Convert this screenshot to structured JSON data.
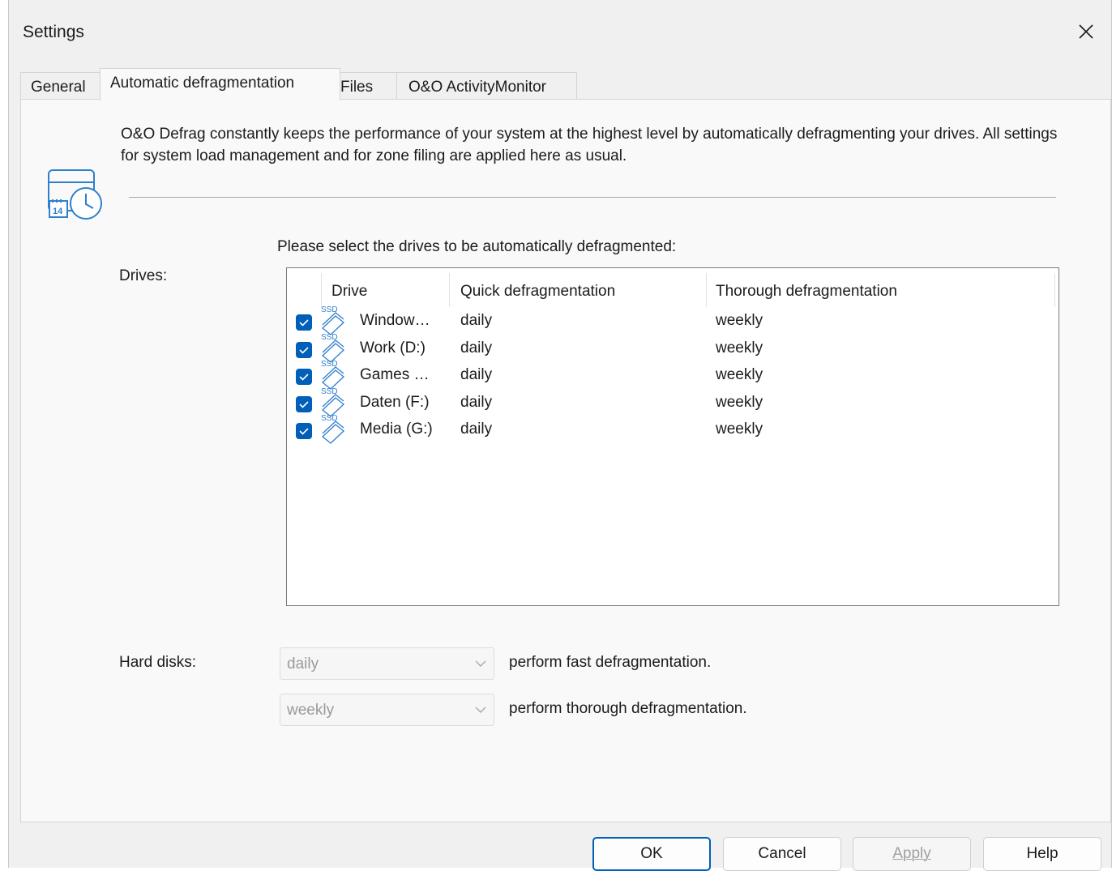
{
  "window": {
    "title": "Settings"
  },
  "tabs": [
    {
      "label": "General"
    },
    {
      "label": "Automatic defragmentation"
    },
    {
      "label": "Files"
    },
    {
      "label": "O&O ActivityMonitor"
    }
  ],
  "description": "O&O Defrag constantly keeps the performance of your system at the highest level by automatically defragmenting your drives. All settings for system load management and for zone filing are applied here as usual.",
  "drives_label": "Drives:",
  "drives_prompt": "Please select the drives to be automatically defragmented:",
  "table": {
    "columns": [
      "Drive",
      "Quick defragmentation",
      "Thorough defragmentation"
    ],
    "rows": [
      {
        "checked": true,
        "icon": "ssd-icon",
        "icon_text": "SSD",
        "drive": "Window…",
        "quick": "daily",
        "thorough": "weekly"
      },
      {
        "checked": true,
        "icon": "ssd-icon",
        "icon_text": "SSD",
        "drive": "Work (D:)",
        "quick": "daily",
        "thorough": "weekly"
      },
      {
        "checked": true,
        "icon": "ssd-icon",
        "icon_text": "SSD",
        "drive": "Games …",
        "quick": "daily",
        "thorough": "weekly"
      },
      {
        "checked": true,
        "icon": "ssd-icon",
        "icon_text": "SSD",
        "drive": "Daten (F:)",
        "quick": "daily",
        "thorough": "weekly"
      },
      {
        "checked": true,
        "icon": "ssd-icon",
        "icon_text": "SSD",
        "drive": "Media (G:)",
        "quick": "daily",
        "thorough": "weekly"
      }
    ]
  },
  "hard_disks": {
    "label": "Hard disks:",
    "fast_value": "daily",
    "fast_text": "perform fast defragmentation.",
    "thorough_value": "weekly",
    "thorough_text": "perform thorough defragmentation."
  },
  "buttons": {
    "ok": "OK",
    "cancel": "Cancel",
    "apply": "Apply",
    "help": "Help"
  },
  "colors": {
    "accent": "#005fb8",
    "background": "#f0f0f0",
    "panel": "#f9f9f9"
  },
  "icons": {
    "close": "close-icon",
    "page": "calendar-clock-icon",
    "dropdown": "chevron-down-icon"
  }
}
